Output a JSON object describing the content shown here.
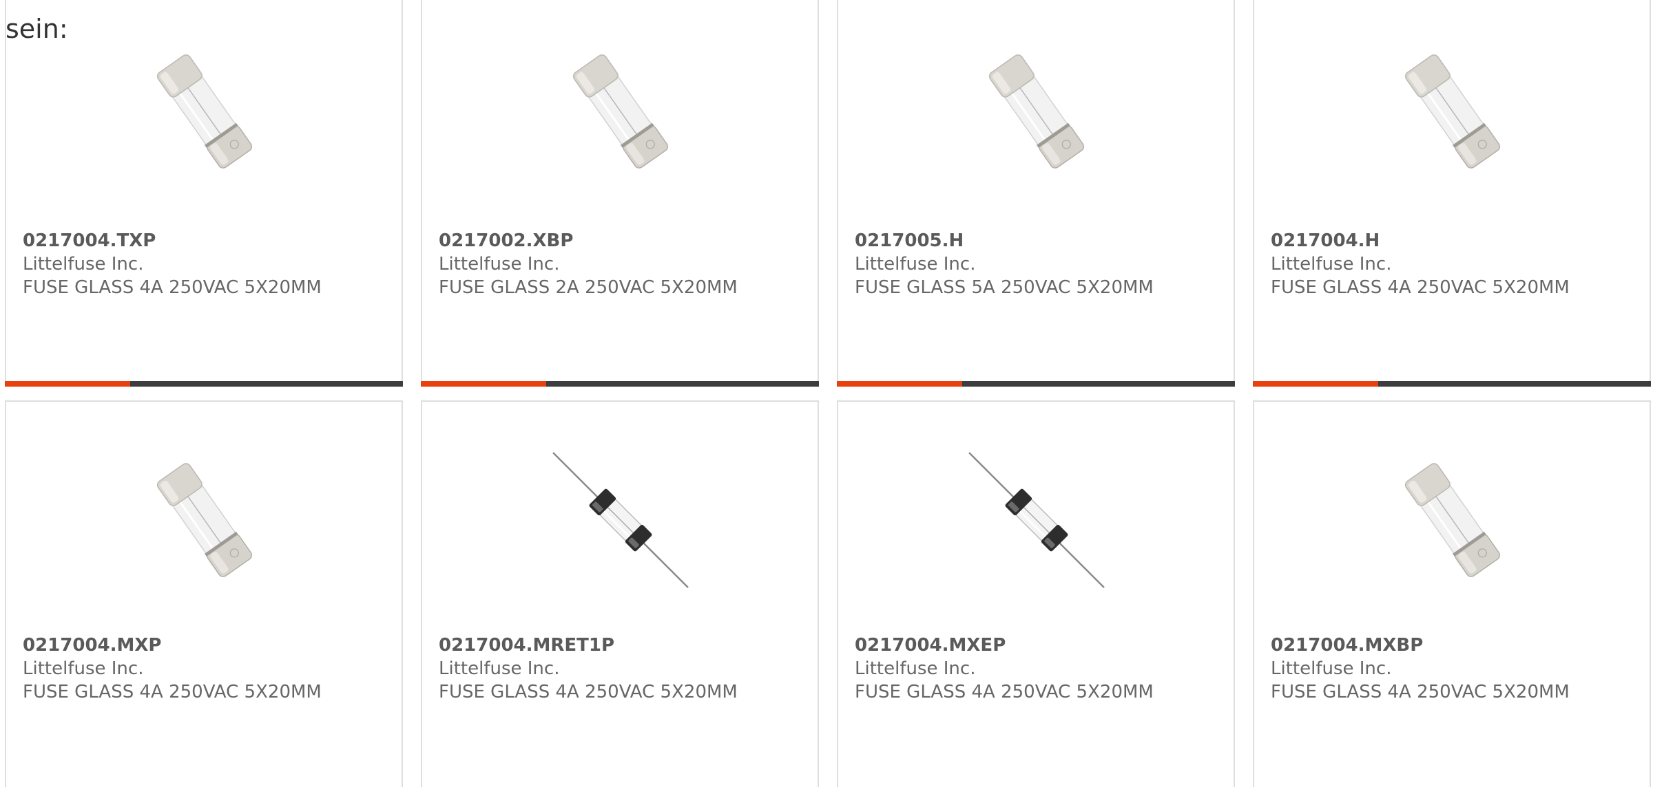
{
  "intro_text": "sein:",
  "colors": {
    "accent": "#e8410f",
    "bar_dark": "#3d3d3d",
    "card_border": "#dedede",
    "text": "#666666"
  },
  "products": [
    {
      "part_number": "0217004.TXP",
      "manufacturer": "Littelfuse Inc.",
      "description": "FUSE GLASS 4A 250VAC 5X20MM",
      "image": "glass-cartridge-fuse-icon"
    },
    {
      "part_number": "0217002.XBP",
      "manufacturer": "Littelfuse Inc.",
      "description": "FUSE GLASS 2A 250VAC 5X20MM",
      "image": "glass-cartridge-fuse-icon"
    },
    {
      "part_number": "0217005.H",
      "manufacturer": "Littelfuse Inc.",
      "description": "FUSE GLASS 5A 250VAC 5X20MM",
      "image": "glass-cartridge-fuse-icon"
    },
    {
      "part_number": "0217004.H",
      "manufacturer": "Littelfuse Inc.",
      "description": "FUSE GLASS 4A 250VAC 5X20MM",
      "image": "glass-cartridge-fuse-icon"
    },
    {
      "part_number": "0217004.MXP",
      "manufacturer": "Littelfuse Inc.",
      "description": "FUSE GLASS 4A 250VAC 5X20MM",
      "image": "glass-cartridge-fuse-icon"
    },
    {
      "part_number": "0217004.MRET1P",
      "manufacturer": "Littelfuse Inc.",
      "description": "FUSE GLASS 4A 250VAC 5X20MM",
      "image": "axial-lead-fuse-icon"
    },
    {
      "part_number": "0217004.MXEP",
      "manufacturer": "Littelfuse Inc.",
      "description": "FUSE GLASS 4A 250VAC 5X20MM",
      "image": "axial-lead-fuse-icon"
    },
    {
      "part_number": "0217004.MXBP",
      "manufacturer": "Littelfuse Inc.",
      "description": "FUSE GLASS 4A 250VAC 5X20MM",
      "image": "glass-cartridge-fuse-icon"
    }
  ]
}
